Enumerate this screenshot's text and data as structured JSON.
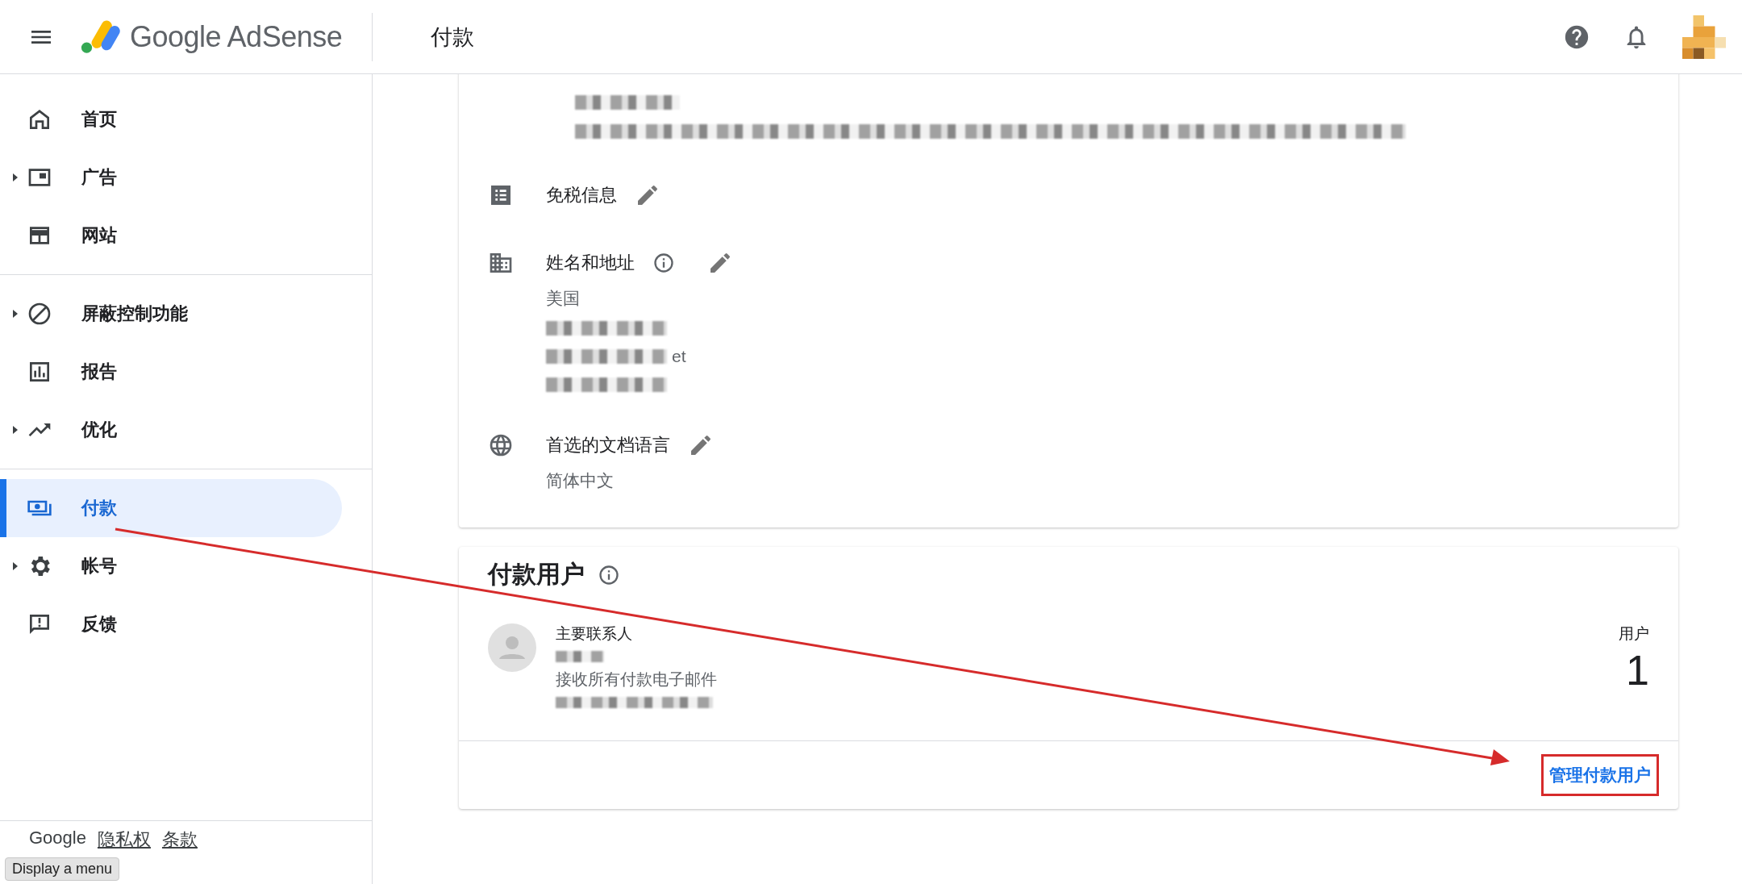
{
  "header": {
    "brand": "Google AdSense",
    "page_title": "付款"
  },
  "sidebar": {
    "sections": [
      {
        "items": [
          {
            "label": "首页",
            "expandable": false,
            "selected": false
          },
          {
            "label": "广告",
            "expandable": true,
            "selected": false
          },
          {
            "label": "网站",
            "expandable": false,
            "selected": false
          }
        ]
      },
      {
        "items": [
          {
            "label": "屏蔽控制功能",
            "expandable": true,
            "selected": false
          },
          {
            "label": "报告",
            "expandable": false,
            "selected": false
          },
          {
            "label": "优化",
            "expandable": true,
            "selected": false
          }
        ]
      },
      {
        "items": [
          {
            "label": "付款",
            "expandable": false,
            "selected": true
          },
          {
            "label": "帐号",
            "expandable": true,
            "selected": false
          },
          {
            "label": "反馈",
            "expandable": false,
            "selected": false
          }
        ]
      }
    ],
    "footer_links": [
      "Google",
      "隐私权",
      "条款"
    ],
    "tooltip": "Display a menu"
  },
  "settings_card": {
    "rows": [
      {
        "label": "免税信息",
        "info": false,
        "values": [],
        "fragment": ""
      },
      {
        "label": "姓名和地址",
        "info": true,
        "values": [
          "美国"
        ],
        "fragment": "et"
      },
      {
        "label": "首选的文档语言",
        "info": false,
        "values": [
          "简体中文"
        ],
        "fragment": ""
      }
    ]
  },
  "payment_users": {
    "title": "付款用户",
    "role": "主要联系人",
    "note": "接收所有付款电子邮件",
    "count_label": "用户",
    "count": "1",
    "action": "管理付款用户"
  }
}
